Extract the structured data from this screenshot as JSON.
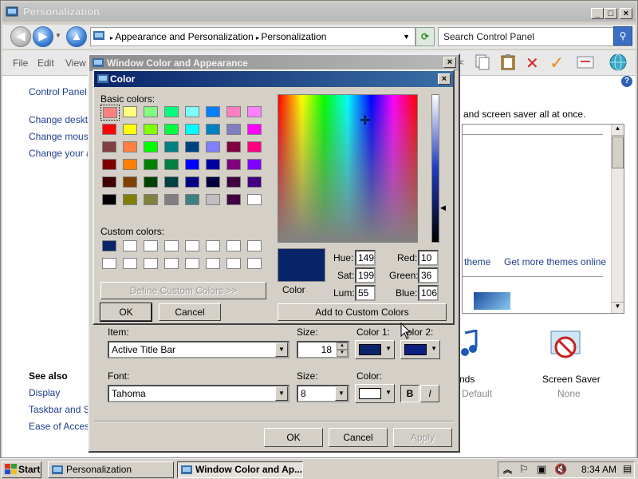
{
  "explorer": {
    "title": "Personalization",
    "breadcrumb": [
      "Appearance and Personalization",
      "Personalization"
    ],
    "search_placeholder": "Search Control Panel",
    "menu": [
      "File",
      "Edit",
      "View"
    ],
    "left_links": [
      "Control Panel H",
      "Change desktop",
      "Change mouse",
      "Change your ac"
    ],
    "see_also": "See also",
    "see_also_links": [
      "Display",
      "Taskbar and Start",
      "Ease of Access"
    ],
    "main_text": "and screen saver all at once.",
    "theme_link": "theme",
    "more_themes_link": "Get more themes online",
    "sounds_label": "nds",
    "sounds_value": "Default",
    "screen_saver_label": "Screen Saver",
    "screen_saver_value": "None"
  },
  "wca": {
    "title": "Window Color and Appearance",
    "item_label": "Item:",
    "item_value": "Active Title Bar",
    "size_label": "Size:",
    "size_value": "18",
    "color1_label": "Color 1:",
    "color2_label": "olor 2:",
    "font_label": "Font:",
    "font_value": "Tahoma",
    "font_size_label": "Size:",
    "font_size_value": "8",
    "font_color_label": "Color:",
    "bold_label": "B",
    "italic_label": "I",
    "ok": "OK",
    "cancel": "Cancel",
    "apply": "Apply",
    "color1": "#0a246a",
    "color2": "#0a1f80",
    "font_color": "#ffffff"
  },
  "color_dialog": {
    "title": "Color",
    "basic_colors_label": "Basic colors:",
    "custom_colors_label": "Custom colors:",
    "define_custom": "Define Custom Colors >>",
    "ok": "OK",
    "cancel": "Cancel",
    "add_to_custom": "Add to Custom Colors",
    "color_solid_label": "Color",
    "hue_label": "Hue:",
    "hue": "149",
    "sat_label": "Sat:",
    "sat": "199",
    "lum_label": "Lum:",
    "lum": "55",
    "red_label": "Red:",
    "red": "10",
    "green_label": "Green:",
    "green": "36",
    "blue_label": "Blue:",
    "blue": "106",
    "current_color": "#0a246a",
    "basic_colors": [
      [
        "#ff8080",
        "#ffff80",
        "#80ff80",
        "#00ff80",
        "#80ffff",
        "#0080ff",
        "#ff80c0",
        "#ff80ff"
      ],
      [
        "#ff0000",
        "#ffff00",
        "#80ff00",
        "#00ff40",
        "#00ffff",
        "#0080c0",
        "#8080c0",
        "#ff00ff"
      ],
      [
        "#804040",
        "#ff8040",
        "#00ff00",
        "#008080",
        "#004080",
        "#8080ff",
        "#800040",
        "#ff0080"
      ],
      [
        "#800000",
        "#ff8000",
        "#008000",
        "#008040",
        "#0000ff",
        "#0000a0",
        "#800080",
        "#8000ff"
      ],
      [
        "#400000",
        "#804000",
        "#004000",
        "#004040",
        "#000080",
        "#000040",
        "#400040",
        "#400080"
      ],
      [
        "#000000",
        "#808000",
        "#808040",
        "#808080",
        "#408080",
        "#c0c0c0",
        "#400040",
        "#ffffff"
      ]
    ],
    "custom_colors": [
      [
        "#0a246a",
        "#ffffff",
        "#ffffff",
        "#ffffff",
        "#ffffff",
        "#ffffff",
        "#ffffff",
        "#ffffff"
      ],
      [
        "#ffffff",
        "#ffffff",
        "#ffffff",
        "#ffffff",
        "#ffffff",
        "#ffffff",
        "#ffffff",
        "#ffffff"
      ]
    ]
  },
  "taskbar": {
    "start": "Start",
    "task1": "Personalization",
    "task2": "Window Color and Ap...",
    "clock": "8:34 AM"
  }
}
